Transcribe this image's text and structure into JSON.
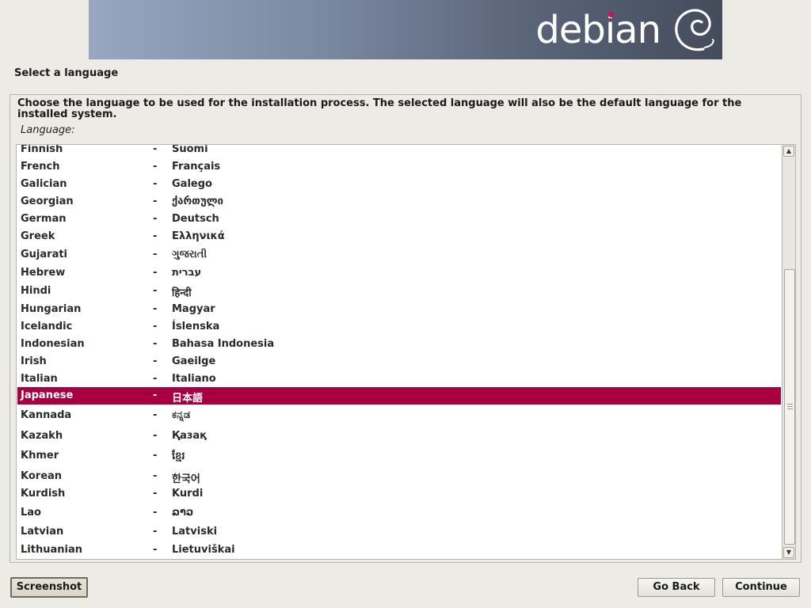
{
  "header": {
    "brand": "debian"
  },
  "page_title": "Select a language",
  "prompt": "Choose the language to be used for the installation process. The selected language will also be the default language for the installed system.",
  "list_label": "Language:",
  "colors": {
    "selection": "#a60042",
    "banner_dark": "#444c5c",
    "banner_light": "#98a6c2",
    "brand_dot": "#d70a53"
  },
  "languages": [
    {
      "english": "Finnish",
      "native": "Suomi"
    },
    {
      "english": "French",
      "native": "Français"
    },
    {
      "english": "Galician",
      "native": "Galego"
    },
    {
      "english": "Georgian",
      "native": "ქართული"
    },
    {
      "english": "German",
      "native": "Deutsch"
    },
    {
      "english": "Greek",
      "native": "Ελληνικά"
    },
    {
      "english": "Gujarati",
      "native": "ગુજરાતી"
    },
    {
      "english": "Hebrew",
      "native": "עברית"
    },
    {
      "english": "Hindi",
      "native": "हिन्दी"
    },
    {
      "english": "Hungarian",
      "native": "Magyar"
    },
    {
      "english": "Icelandic",
      "native": "Íslenska"
    },
    {
      "english": "Indonesian",
      "native": "Bahasa Indonesia"
    },
    {
      "english": "Irish",
      "native": "Gaeilge"
    },
    {
      "english": "Italian",
      "native": "Italiano"
    },
    {
      "english": "Japanese",
      "native": "日本語",
      "selected": true
    },
    {
      "english": "Kannada",
      "native": "ಕನ್ನಡ"
    },
    {
      "english": "Kazakh",
      "native": "Қазақ"
    },
    {
      "english": "Khmer",
      "native": "ខ្មែរ"
    },
    {
      "english": "Korean",
      "native": "한국어"
    },
    {
      "english": "Kurdish",
      "native": "Kurdi"
    },
    {
      "english": "Lao",
      "native": "ລາວ"
    },
    {
      "english": "Latvian",
      "native": "Latviski"
    },
    {
      "english": "Lithuanian",
      "native": "Lietuviškai"
    }
  ],
  "separator": "-",
  "scrollbar": {
    "up_icon": "arrow-up-icon",
    "down_icon": "arrow-down-icon"
  },
  "buttons": {
    "screenshot": "Screenshot",
    "go_back": "Go Back",
    "continue": "Continue"
  }
}
